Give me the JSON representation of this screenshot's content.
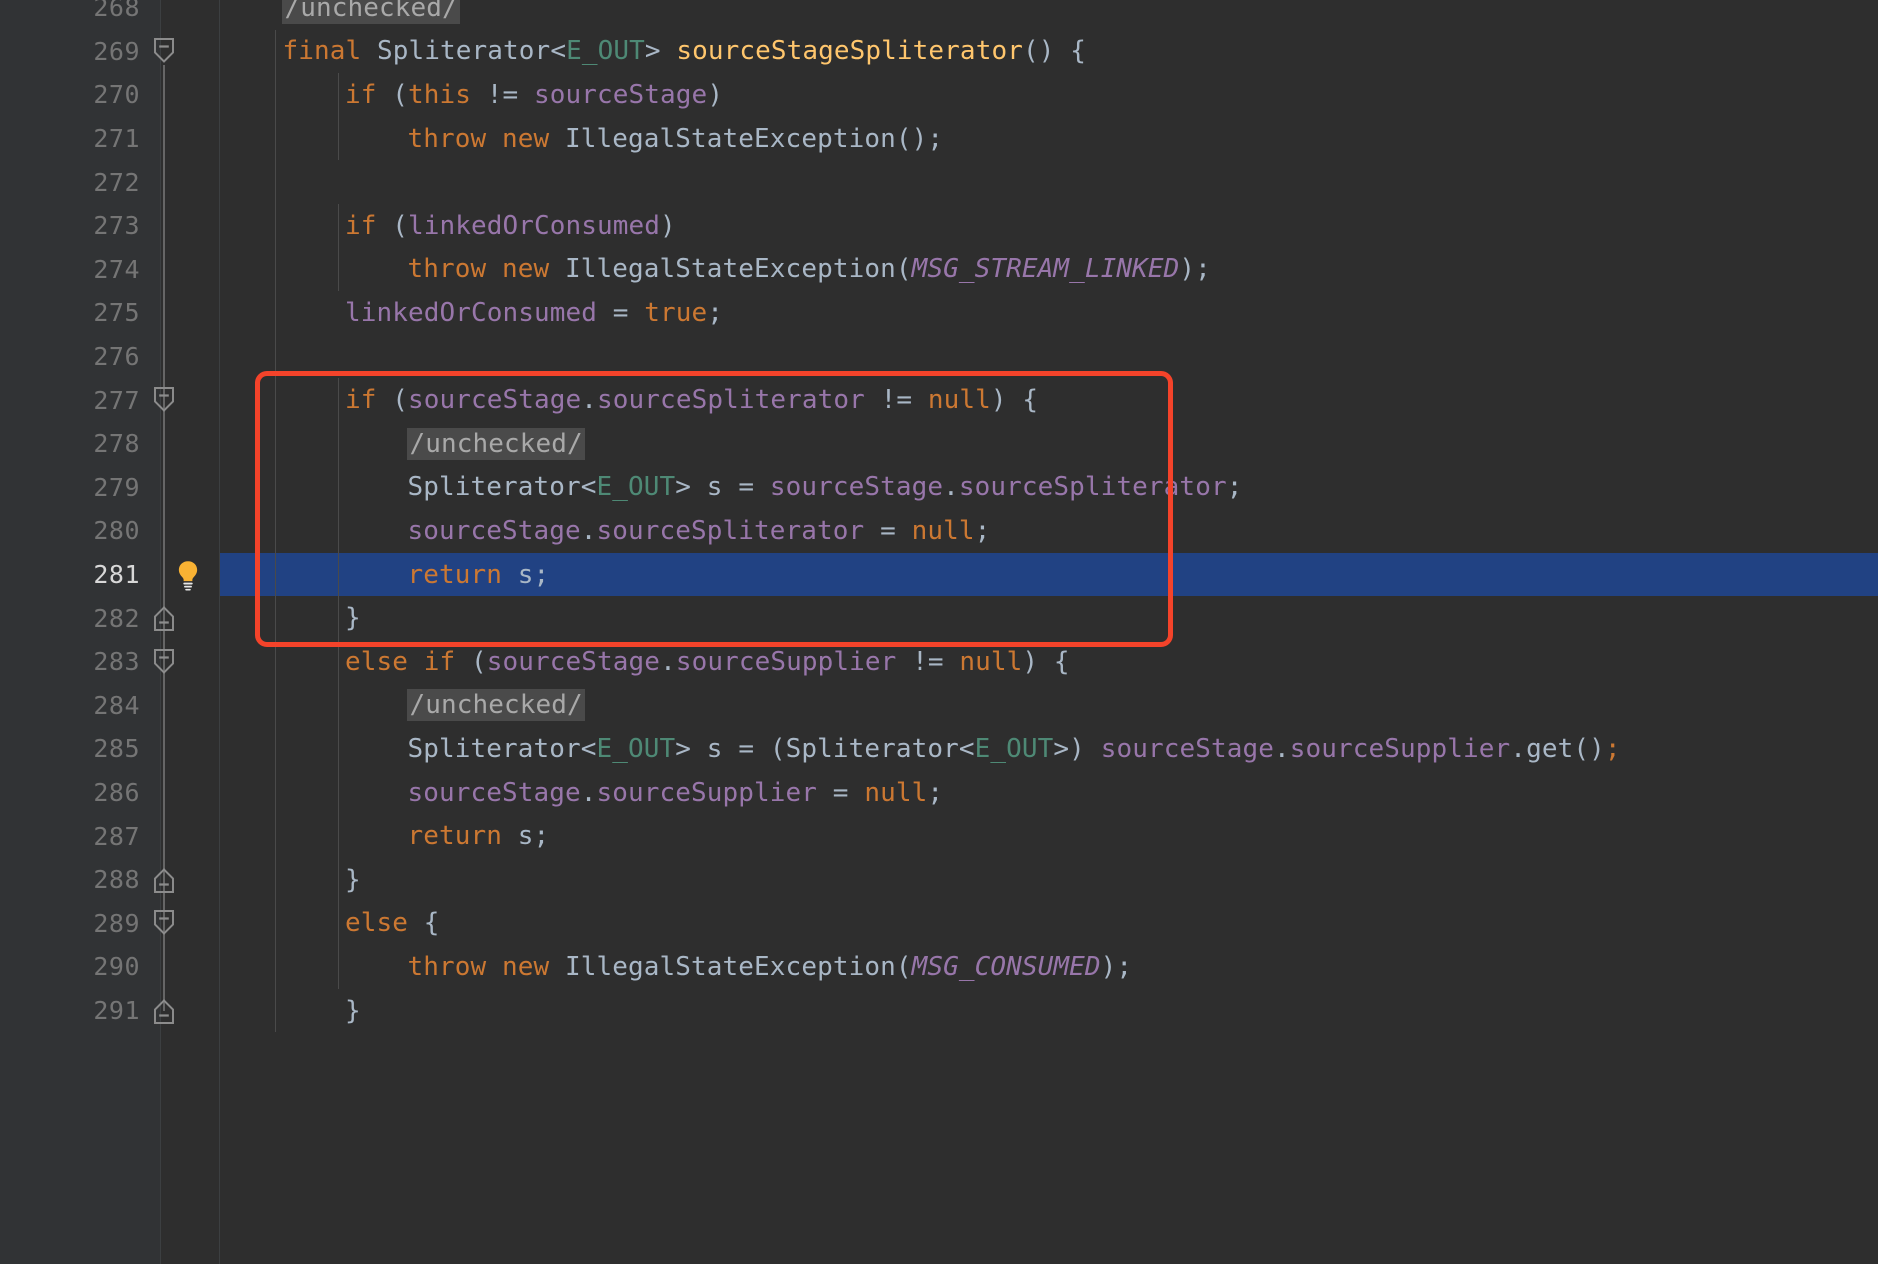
{
  "editor": {
    "language": "java",
    "theme": "darcula",
    "background": "#2E2E2E",
    "gutter_background": "#313335",
    "selected_line_background": "#214283",
    "annotation_color": "#F4432A",
    "selected_line_number": 281,
    "first_line_number": 268,
    "last_line_number": 291
  },
  "icons": {
    "lightbulb": "lightbulb-icon",
    "fold_collapse": "fold-collapse-icon",
    "fold_end": "fold-end-icon"
  },
  "annotation": {
    "name": "red-highlight-rectangle",
    "covers_lines": [
      277,
      278,
      279,
      280,
      281,
      282
    ],
    "color": "#F4432A"
  },
  "lines": [
    {
      "num": "268",
      "indent": 1,
      "text": "/unchecked/",
      "tokens": [
        {
          "t": "/unchecked/",
          "c": "hl"
        }
      ]
    },
    {
      "num": "269",
      "indent": 1,
      "text": "final Spliterator<E_OUT> sourceStageSpliterator() {",
      "tokens": [
        {
          "t": "final",
          "c": "kw"
        },
        {
          "t": " ",
          "c": "pun"
        },
        {
          "t": "Spliterator",
          "c": "cls"
        },
        {
          "t": "<",
          "c": "pun"
        },
        {
          "t": "E_OUT",
          "c": "gen"
        },
        {
          "t": "> ",
          "c": "pun"
        },
        {
          "t": "sourceStageSpliterator",
          "c": "mth"
        },
        {
          "t": "() {",
          "c": "pun"
        }
      ]
    },
    {
      "num": "270",
      "indent": 2,
      "text": "if (this != sourceStage)",
      "tokens": [
        {
          "t": "if",
          "c": "kw"
        },
        {
          "t": " (",
          "c": "pun"
        },
        {
          "t": "this",
          "c": "kw"
        },
        {
          "t": " != ",
          "c": "pun"
        },
        {
          "t": "sourceStage",
          "c": "fld"
        },
        {
          "t": ")",
          "c": "pun"
        }
      ]
    },
    {
      "num": "271",
      "indent": 3,
      "text": "throw new IllegalStateException();",
      "tokens": [
        {
          "t": "throw",
          "c": "kw"
        },
        {
          "t": " ",
          "c": "pun"
        },
        {
          "t": "new",
          "c": "kw"
        },
        {
          "t": " ",
          "c": "pun"
        },
        {
          "t": "IllegalStateException",
          "c": "cls"
        },
        {
          "t": "();",
          "c": "pun"
        }
      ]
    },
    {
      "num": "272",
      "indent": 0,
      "text": "",
      "tokens": []
    },
    {
      "num": "273",
      "indent": 2,
      "text": "if (linkedOrConsumed)",
      "tokens": [
        {
          "t": "if",
          "c": "kw"
        },
        {
          "t": " (",
          "c": "pun"
        },
        {
          "t": "linkedOrConsumed",
          "c": "fld"
        },
        {
          "t": ")",
          "c": "pun"
        }
      ]
    },
    {
      "num": "274",
      "indent": 3,
      "text": "throw new IllegalStateException(MSG_STREAM_LINKED);",
      "tokens": [
        {
          "t": "throw",
          "c": "kw"
        },
        {
          "t": " ",
          "c": "pun"
        },
        {
          "t": "new",
          "c": "kw"
        },
        {
          "t": " ",
          "c": "pun"
        },
        {
          "t": "IllegalStateException",
          "c": "cls"
        },
        {
          "t": "(",
          "c": "pun"
        },
        {
          "t": "MSG_STREAM_LINKED",
          "c": "sfld"
        },
        {
          "t": ");",
          "c": "pun"
        }
      ]
    },
    {
      "num": "275",
      "indent": 2,
      "text": "linkedOrConsumed = true;",
      "tokens": [
        {
          "t": "linkedOrConsumed",
          "c": "fld"
        },
        {
          "t": " = ",
          "c": "pun"
        },
        {
          "t": "true",
          "c": "kw"
        },
        {
          "t": ";",
          "c": "pun"
        }
      ]
    },
    {
      "num": "276",
      "indent": 0,
      "text": "",
      "tokens": []
    },
    {
      "num": "277",
      "indent": 2,
      "text": "if (sourceStage.sourceSpliterator != null) {",
      "tokens": [
        {
          "t": "if",
          "c": "kw"
        },
        {
          "t": " (",
          "c": "pun"
        },
        {
          "t": "sourceStage",
          "c": "fld"
        },
        {
          "t": ".",
          "c": "pun"
        },
        {
          "t": "sourceSpliterator",
          "c": "fld"
        },
        {
          "t": " != ",
          "c": "pun"
        },
        {
          "t": "null",
          "c": "kw"
        },
        {
          "t": ") {",
          "c": "pun"
        }
      ]
    },
    {
      "num": "278",
      "indent": 3,
      "text": "/unchecked/",
      "tokens": [
        {
          "t": "/unchecked/",
          "c": "hl"
        }
      ]
    },
    {
      "num": "279",
      "indent": 3,
      "text": "Spliterator<E_OUT> s = sourceStage.sourceSpliterator;",
      "tokens": [
        {
          "t": "Spliterator",
          "c": "cls"
        },
        {
          "t": "<",
          "c": "pun"
        },
        {
          "t": "E_OUT",
          "c": "gen"
        },
        {
          "t": "> ",
          "c": "pun"
        },
        {
          "t": "s",
          "c": "cls"
        },
        {
          "t": " = ",
          "c": "pun"
        },
        {
          "t": "sourceStage",
          "c": "fld"
        },
        {
          "t": ".",
          "c": "pun"
        },
        {
          "t": "sourceSpliterator",
          "c": "fld"
        },
        {
          "t": ";",
          "c": "pun"
        }
      ]
    },
    {
      "num": "280",
      "indent": 3,
      "text": "sourceStage.sourceSpliterator = null;",
      "tokens": [
        {
          "t": "sourceStage",
          "c": "fld"
        },
        {
          "t": ".",
          "c": "pun"
        },
        {
          "t": "sourceSpliterator",
          "c": "fld"
        },
        {
          "t": " = ",
          "c": "pun"
        },
        {
          "t": "null",
          "c": "kw"
        },
        {
          "t": ";",
          "c": "pun"
        }
      ]
    },
    {
      "num": "281",
      "indent": 3,
      "text": "return s;",
      "selected": true,
      "tokens": [
        {
          "t": "return",
          "c": "kw"
        },
        {
          "t": " ",
          "c": "pun"
        },
        {
          "t": "s",
          "c": "cls"
        },
        {
          "t": ";",
          "c": "pun"
        }
      ]
    },
    {
      "num": "282",
      "indent": 2,
      "text": "}",
      "tokens": [
        {
          "t": "}",
          "c": "pun"
        }
      ]
    },
    {
      "num": "283",
      "indent": 2,
      "text": "else if (sourceStage.sourceSupplier != null) {",
      "tokens": [
        {
          "t": "else",
          "c": "kw"
        },
        {
          "t": " ",
          "c": "pun"
        },
        {
          "t": "if",
          "c": "kw"
        },
        {
          "t": " (",
          "c": "pun"
        },
        {
          "t": "sourceStage",
          "c": "fld"
        },
        {
          "t": ".",
          "c": "pun"
        },
        {
          "t": "sourceSupplier",
          "c": "fld"
        },
        {
          "t": " != ",
          "c": "pun"
        },
        {
          "t": "null",
          "c": "kw"
        },
        {
          "t": ") {",
          "c": "pun"
        }
      ]
    },
    {
      "num": "284",
      "indent": 3,
      "text": "/unchecked/",
      "tokens": [
        {
          "t": "/unchecked/",
          "c": "hl"
        }
      ]
    },
    {
      "num": "285",
      "indent": 3,
      "text": "Spliterator<E_OUT> s = (Spliterator<E_OUT>) sourceStage.sourceSupplier.get();",
      "tokens": [
        {
          "t": "Spliterator",
          "c": "cls"
        },
        {
          "t": "<",
          "c": "pun"
        },
        {
          "t": "E_OUT",
          "c": "gen"
        },
        {
          "t": "> ",
          "c": "pun"
        },
        {
          "t": "s",
          "c": "cls"
        },
        {
          "t": " = (",
          "c": "pun"
        },
        {
          "t": "Spliterator",
          "c": "cls"
        },
        {
          "t": "<",
          "c": "pun"
        },
        {
          "t": "E_OUT",
          "c": "gen"
        },
        {
          "t": ">) ",
          "c": "pun"
        },
        {
          "t": "sourceStage",
          "c": "fld"
        },
        {
          "t": ".",
          "c": "pun"
        },
        {
          "t": "sourceSupplier",
          "c": "fld"
        },
        {
          "t": ".",
          "c": "pun"
        },
        {
          "t": "get",
          "c": "cls"
        },
        {
          "t": "()",
          "c": "pun"
        },
        {
          "t": ";",
          "c": "semi"
        }
      ]
    },
    {
      "num": "286",
      "indent": 3,
      "text": "sourceStage.sourceSupplier = null;",
      "tokens": [
        {
          "t": "sourceStage",
          "c": "fld"
        },
        {
          "t": ".",
          "c": "pun"
        },
        {
          "t": "sourceSupplier",
          "c": "fld"
        },
        {
          "t": " = ",
          "c": "pun"
        },
        {
          "t": "null",
          "c": "kw"
        },
        {
          "t": ";",
          "c": "pun"
        }
      ]
    },
    {
      "num": "287",
      "indent": 3,
      "text": "return s;",
      "tokens": [
        {
          "t": "return",
          "c": "kw"
        },
        {
          "t": " ",
          "c": "pun"
        },
        {
          "t": "s",
          "c": "cls"
        },
        {
          "t": ";",
          "c": "pun"
        }
      ]
    },
    {
      "num": "288",
      "indent": 2,
      "text": "}",
      "tokens": [
        {
          "t": "}",
          "c": "pun"
        }
      ]
    },
    {
      "num": "289",
      "indent": 2,
      "text": "else {",
      "tokens": [
        {
          "t": "else",
          "c": "kw"
        },
        {
          "t": " {",
          "c": "pun"
        }
      ]
    },
    {
      "num": "290",
      "indent": 3,
      "text": "throw new IllegalStateException(MSG_CONSUMED);",
      "tokens": [
        {
          "t": "throw",
          "c": "kw"
        },
        {
          "t": " ",
          "c": "pun"
        },
        {
          "t": "new",
          "c": "kw"
        },
        {
          "t": " ",
          "c": "pun"
        },
        {
          "t": "IllegalStateException",
          "c": "cls"
        },
        {
          "t": "(",
          "c": "pun"
        },
        {
          "t": "MSG_CONSUMED",
          "c": "sfld"
        },
        {
          "t": ");",
          "c": "pun"
        }
      ]
    },
    {
      "num": "291",
      "indent": 2,
      "text": "}",
      "tokens": [
        {
          "t": "}",
          "c": "pun"
        }
      ]
    }
  ],
  "fold_markers": [
    {
      "line": "269",
      "type": "collapse"
    },
    {
      "line": "277",
      "type": "collapse"
    },
    {
      "line": "282",
      "type": "end"
    },
    {
      "line": "283",
      "type": "collapse"
    },
    {
      "line": "288",
      "type": "end"
    },
    {
      "line": "289",
      "type": "collapse"
    },
    {
      "line": "291",
      "type": "end"
    }
  ]
}
